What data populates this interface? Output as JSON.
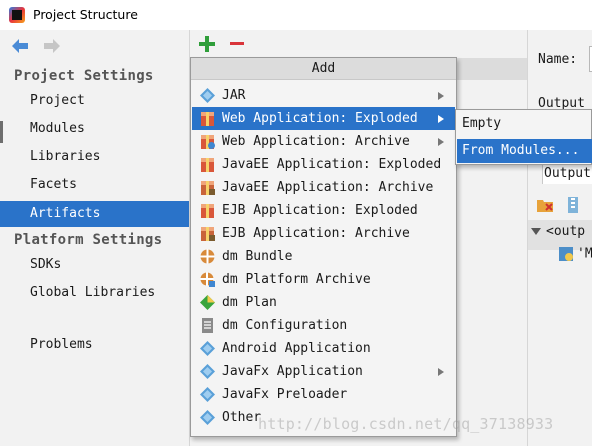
{
  "window": {
    "title": "Project Structure"
  },
  "sidebar": {
    "project_settings_title": "Project Settings",
    "project_items": [
      {
        "label": "Project"
      },
      {
        "label": "Modules"
      },
      {
        "label": "Libraries"
      },
      {
        "label": "Facets"
      },
      {
        "label": "Artifacts",
        "selected": true
      }
    ],
    "platform_settings_title": "Platform Settings",
    "platform_items": [
      {
        "label": "SDKs"
      },
      {
        "label": "Global Libraries"
      }
    ],
    "problems_label": "Problems"
  },
  "toolbar": {
    "add_icon": "plus-icon",
    "remove_icon": "minus-icon"
  },
  "add_menu": {
    "title": "Add",
    "items": [
      {
        "label": "JAR",
        "icon": "jar-icon",
        "has_submenu": true
      },
      {
        "label": "Web Application: Exploded",
        "icon": "web-exploded-icon",
        "has_submenu": true,
        "highlighted": true
      },
      {
        "label": "Web Application: Archive",
        "icon": "web-archive-icon",
        "has_submenu": true
      },
      {
        "label": "JavaEE Application: Exploded",
        "icon": "javaee-exploded-icon"
      },
      {
        "label": "JavaEE Application: Archive",
        "icon": "javaee-archive-icon"
      },
      {
        "label": "EJB Application: Exploded",
        "icon": "ejb-exploded-icon"
      },
      {
        "label": "EJB Application: Archive",
        "icon": "ejb-archive-icon"
      },
      {
        "label": "dm Bundle",
        "icon": "dm-bundle-icon"
      },
      {
        "label": "dm Platform Archive",
        "icon": "dm-platform-icon"
      },
      {
        "label": "dm Plan",
        "icon": "dm-plan-icon"
      },
      {
        "label": "dm Configuration",
        "icon": "dm-config-icon"
      },
      {
        "label": "Android Application",
        "icon": "android-icon"
      },
      {
        "label": "JavaFx Application",
        "icon": "javafx-app-icon",
        "has_submenu": true
      },
      {
        "label": "JavaFx Preloader",
        "icon": "javafx-preloader-icon"
      },
      {
        "label": "Other",
        "icon": "other-icon"
      }
    ]
  },
  "submenu": {
    "items": [
      {
        "label": "Empty"
      },
      {
        "label": "From Modules...",
        "highlighted": true
      }
    ]
  },
  "right_panel": {
    "name_label": "Name:",
    "output_label": "Output",
    "output_tab": "Output",
    "tree_root": "<outp",
    "tree_child": "'M"
  },
  "watermark": "http://blog.csdn.net/qq_37138933",
  "colors": {
    "selection": "#2a73c9",
    "background": "#f2f2f2"
  }
}
